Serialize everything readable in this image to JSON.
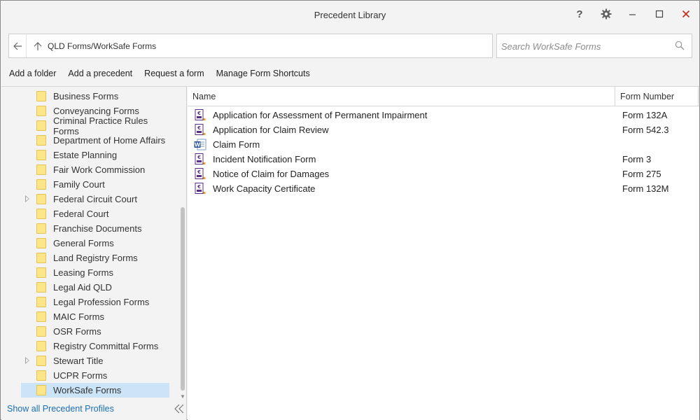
{
  "window": {
    "title": "Precedent Library",
    "help_label": "?"
  },
  "address": {
    "path": "QLD Forms/WorkSafe Forms"
  },
  "search": {
    "placeholder": "Search WorkSafe Forms",
    "value": ""
  },
  "toolbar": {
    "add_folder": "Add a folder",
    "add_precedent": "Add a precedent",
    "request_form": "Request a form",
    "manage_shortcuts": "Manage Form Shortcuts"
  },
  "tree": {
    "items": [
      {
        "label": "Business Forms",
        "expandable": false
      },
      {
        "label": "Conveyancing Forms",
        "expandable": false
      },
      {
        "label": "Criminal Practice Rules Forms",
        "expandable": false
      },
      {
        "label": "Department of Home Affairs",
        "expandable": false
      },
      {
        "label": "Estate Planning",
        "expandable": false
      },
      {
        "label": "Fair Work Commission",
        "expandable": false
      },
      {
        "label": "Family Court",
        "expandable": false
      },
      {
        "label": "Federal Circuit Court",
        "expandable": true
      },
      {
        "label": "Federal Court",
        "expandable": false
      },
      {
        "label": "Franchise Documents",
        "expandable": false
      },
      {
        "label": "General Forms",
        "expandable": false
      },
      {
        "label": "Land Registry Forms",
        "expandable": false
      },
      {
        "label": "Leasing Forms",
        "expandable": false
      },
      {
        "label": "Legal Aid QLD",
        "expandable": false
      },
      {
        "label": "Legal Profession Forms",
        "expandable": false
      },
      {
        "label": "MAIC Forms",
        "expandable": false
      },
      {
        "label": "OSR Forms",
        "expandable": false
      },
      {
        "label": "Registry Committal Forms",
        "expandable": false
      },
      {
        "label": "Stewart Title",
        "expandable": true
      },
      {
        "label": "UCPR Forms",
        "expandable": false
      },
      {
        "label": "WorkSafe Forms",
        "expandable": false,
        "selected": true
      }
    ],
    "show_all_label": "Show all Precedent Profiles"
  },
  "list": {
    "columns": {
      "name": "Name",
      "form_number": "Form Number"
    },
    "rows": [
      {
        "name": "Application for Assessment of Permanent Impairment",
        "form_number": "Form 132A",
        "icon": "form-document-icon"
      },
      {
        "name": "Application for Claim Review",
        "form_number": "Form 542.3",
        "icon": "form-document-icon"
      },
      {
        "name": "Claim Form",
        "form_number": "",
        "icon": "word-document-icon"
      },
      {
        "name": "Incident Notification Form",
        "form_number": "Form 3",
        "icon": "form-document-icon"
      },
      {
        "name": "Notice of Claim for Damages",
        "form_number": "Form 275",
        "icon": "form-document-icon"
      },
      {
        "name": "Work Capacity Certificate",
        "form_number": "Form 132M",
        "icon": "form-document-icon"
      }
    ]
  },
  "colors": {
    "accent": "#1b6fb5",
    "selection": "#cce4f7",
    "close": "#c42b1c",
    "folder": "#fde58a",
    "form_icon": "#5b2d82"
  }
}
